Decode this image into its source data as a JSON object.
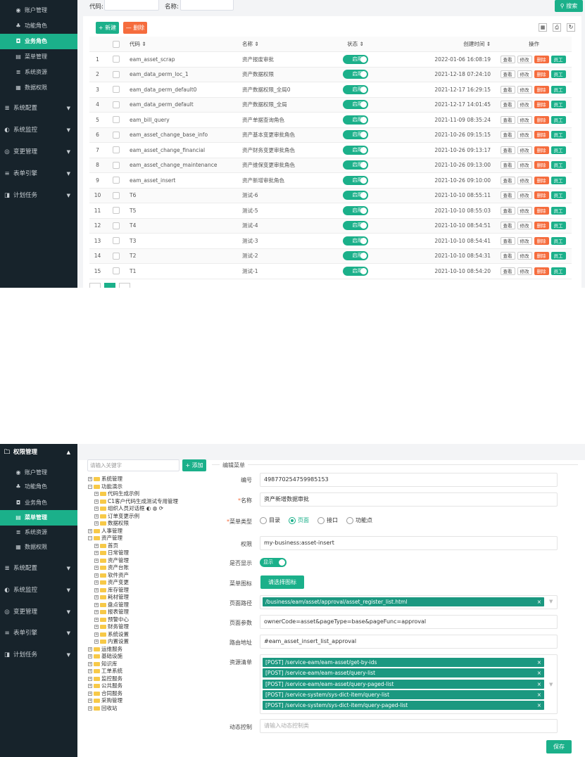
{
  "s1": {
    "sidebar": [
      {
        "icon": "◉",
        "label": "账户管理",
        "kind": "sub"
      },
      {
        "icon": "♣",
        "label": "功能角色",
        "kind": "sub"
      },
      {
        "icon": "◘",
        "label": "业务角色",
        "kind": "sub",
        "active": true
      },
      {
        "icon": "▤",
        "label": "菜单管理",
        "kind": "sub"
      },
      {
        "icon": "≣",
        "label": "系统资源",
        "kind": "sub"
      },
      {
        "icon": "▦",
        "label": "数据权限",
        "kind": "sub"
      },
      {
        "icon": "≣",
        "label": "系统配置",
        "kind": "top"
      },
      {
        "icon": "◐",
        "label": "系统监控",
        "kind": "top"
      },
      {
        "icon": "◎",
        "label": "变更管理",
        "kind": "top"
      },
      {
        "icon": "≡",
        "label": "表单引擎",
        "kind": "top"
      },
      {
        "icon": "◨",
        "label": "计划任务",
        "kind": "top"
      }
    ],
    "search": {
      "code_label": "代码:",
      "name_label": "名称:",
      "search_btn": "⚲ 搜索"
    },
    "toolbar": {
      "new_btn": "+ 新建",
      "del_btn": "— 删除"
    },
    "columns": {
      "code": "代码 ⇕",
      "name": "名称 ⇕",
      "status": "状态 ⇕",
      "created": "创建时间 ⇕",
      "ops": "操作"
    },
    "ops": {
      "view": "查看",
      "edit": "修改",
      "del": "删除",
      "staff": "员工"
    },
    "status_label": "启用",
    "rows": [
      {
        "n": "1",
        "code": "eam_asset_scrap",
        "name": "资产报废审批",
        "time": "2022-01-06 16:08:19"
      },
      {
        "n": "2",
        "code": "eam_data_perm_loc_1",
        "name": "资产数据权限",
        "time": "2021-12-18 07:24:10"
      },
      {
        "n": "3",
        "code": "eam_data_perm_default0",
        "name": "资产数据权限_全局0",
        "time": "2021-12-17 16:29:15"
      },
      {
        "n": "4",
        "code": "eam_data_perm_default",
        "name": "资产数据权限_全局",
        "time": "2021-12-17 14:01:45"
      },
      {
        "n": "5",
        "code": "eam_bill_query",
        "name": "资产单据查询角色",
        "time": "2021-11-09 08:35:24"
      },
      {
        "n": "6",
        "code": "eam_asset_change_base_info",
        "name": "资产基本变更审批角色",
        "time": "2021-10-26 09:15:15"
      },
      {
        "n": "7",
        "code": "eam_asset_change_financial",
        "name": "资产财务变更审批角色",
        "time": "2021-10-26 09:13:17"
      },
      {
        "n": "8",
        "code": "eam_asset_change_maintenance",
        "name": "资产维保变更审批角色",
        "time": "2021-10-26 09:13:00"
      },
      {
        "n": "9",
        "code": "eam_asset_insert",
        "name": "资产新增审批角色",
        "time": "2021-10-26 09:10:00"
      },
      {
        "n": "10",
        "code": "T6",
        "name": "测试-6",
        "time": "2021-10-10 08:55:11"
      },
      {
        "n": "11",
        "code": "T5",
        "name": "测试-5",
        "time": "2021-10-10 08:55:03"
      },
      {
        "n": "12",
        "code": "T4",
        "name": "测试-4",
        "time": "2021-10-10 08:54:51"
      },
      {
        "n": "13",
        "code": "T3",
        "name": "测试-3",
        "time": "2021-10-10 08:54:41"
      },
      {
        "n": "14",
        "code": "T2",
        "name": "测试-2",
        "time": "2021-10-10 08:54:31"
      },
      {
        "n": "15",
        "code": "T1",
        "name": "测试-1",
        "time": "2021-10-10 08:54:20"
      }
    ]
  },
  "s2": {
    "sidebar": [
      {
        "icon": "🗀",
        "label": "权限管理",
        "kind": "head"
      },
      {
        "icon": "◉",
        "label": "账户管理",
        "kind": "sub"
      },
      {
        "icon": "♣",
        "label": "功能角色",
        "kind": "sub"
      },
      {
        "icon": "◘",
        "label": "业务角色",
        "kind": "sub"
      },
      {
        "icon": "▤",
        "label": "菜单管理",
        "kind": "sub",
        "active": true
      },
      {
        "icon": "≣",
        "label": "系统资源",
        "kind": "sub"
      },
      {
        "icon": "▦",
        "label": "数据权限",
        "kind": "sub"
      },
      {
        "icon": "≣",
        "label": "系统配置",
        "kind": "top"
      },
      {
        "icon": "◐",
        "label": "系统监控",
        "kind": "top"
      },
      {
        "icon": "◎",
        "label": "变更管理",
        "kind": "top"
      },
      {
        "icon": "≡",
        "label": "表单引擎",
        "kind": "top"
      },
      {
        "icon": "◨",
        "label": "计划任务",
        "kind": "top"
      }
    ],
    "tree_search_placeholder": "请输入关键字",
    "add_btn": "+ 添加",
    "tree": [
      {
        "d": 0,
        "t": "系统管理"
      },
      {
        "d": 0,
        "t": "功能演示",
        "open": true
      },
      {
        "d": 1,
        "t": "代码生成示例"
      },
      {
        "d": 1,
        "t": "C1客户代码生成测试专用管理"
      },
      {
        "d": 1,
        "t": "组织人员对话框 ◐ ◍ ⟳"
      },
      {
        "d": 1,
        "t": "订单变更示例"
      },
      {
        "d": 1,
        "t": "数据权限"
      },
      {
        "d": 0,
        "t": "人事管理"
      },
      {
        "d": 0,
        "t": "资产管理",
        "open": true
      },
      {
        "d": 1,
        "t": "首页"
      },
      {
        "d": 1,
        "t": "日常管理"
      },
      {
        "d": 1,
        "t": "资产管理"
      },
      {
        "d": 1,
        "t": "资产台账"
      },
      {
        "d": 1,
        "t": "软件资产"
      },
      {
        "d": 1,
        "t": "资产变更"
      },
      {
        "d": 1,
        "t": "库存管理"
      },
      {
        "d": 1,
        "t": "耗材管理"
      },
      {
        "d": 1,
        "t": "盘点管理"
      },
      {
        "d": 1,
        "t": "报表管理"
      },
      {
        "d": 1,
        "t": "预警中心"
      },
      {
        "d": 1,
        "t": "财务管理"
      },
      {
        "d": 1,
        "t": "系统设置"
      },
      {
        "d": 1,
        "t": "内置设置"
      },
      {
        "d": 0,
        "t": "运维服务"
      },
      {
        "d": 0,
        "t": "基础设施"
      },
      {
        "d": 0,
        "t": "知识库"
      },
      {
        "d": 0,
        "t": "工单系统"
      },
      {
        "d": 0,
        "t": "监控服务"
      },
      {
        "d": 0,
        "t": "公共服务"
      },
      {
        "d": 0,
        "t": "合同服务"
      },
      {
        "d": 0,
        "t": "采购管理"
      },
      {
        "d": 0,
        "t": "回收站"
      }
    ],
    "form_title": "编辑菜单",
    "labels": {
      "id": "编号",
      "name": "名称",
      "type": "菜单类型",
      "perm": "权限",
      "visible": "是否显示",
      "icon": "菜单图标",
      "path": "页面路径",
      "params": "页面参数",
      "route": "路由地址",
      "res": "资源清单",
      "dyn": "动态控制"
    },
    "id": "498770254759985153",
    "name": "资产新增数据审批",
    "types": [
      "目录",
      "页面",
      "接口",
      "功能点"
    ],
    "selected_type": "页面",
    "perm": "my-business:asset-insert",
    "visible_label": "显示",
    "icon_btn": "请选择图标",
    "path": "/business/eam/asset/approval/asset_register_list.html",
    "params": "ownerCode=asset&pageType=base&pageFunc=approval",
    "route": "#eam_asset_insert_list_approval",
    "resources": [
      "[POST] /service-eam/eam-asset/get-by-ids",
      "[POST] /service-eam/eam-asset/query-list",
      "[POST] /service-eam/eam-asset/query-paged-list",
      "[POST] /service-system/sys-dict-item/query-list",
      "[POST] /service-system/sys-dict-item/query-paged-list"
    ],
    "dyn_placeholder": "请输入动态控制类",
    "save_btn": "保存"
  }
}
